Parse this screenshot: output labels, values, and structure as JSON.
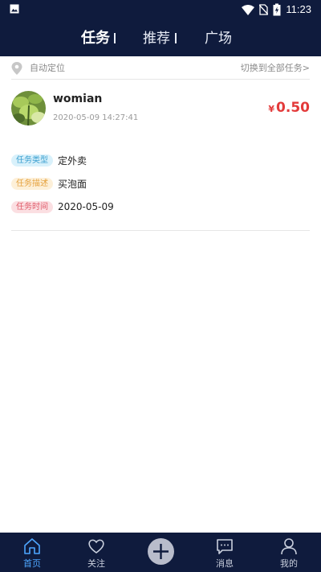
{
  "status_bar": {
    "time": "11:23"
  },
  "top_tabs": [
    {
      "label": "任务",
      "active": true
    },
    {
      "label": "推荐",
      "active": false
    },
    {
      "label": "广场",
      "active": false
    }
  ],
  "location": {
    "label": "自动定位",
    "switch_label": "切换到全部任务>"
  },
  "task": {
    "username": "womian",
    "time": "2020-05-09 14:27:41",
    "price_symbol": "¥",
    "price": "0.50",
    "rows": [
      {
        "tag": "任务类型",
        "value": "定外卖"
      },
      {
        "tag": "任务描述",
        "value": "买泡面"
      },
      {
        "tag": "任务时间",
        "value": "2020-05-09"
      }
    ]
  },
  "bottom_nav": [
    {
      "label": "首页",
      "icon": "home-icon",
      "active": true
    },
    {
      "label": "关注",
      "icon": "heart-icon",
      "active": false
    },
    {
      "label": "",
      "icon": "plus-icon",
      "active": false
    },
    {
      "label": "消息",
      "icon": "message-icon",
      "active": false
    },
    {
      "label": "我的",
      "icon": "user-icon",
      "active": false
    }
  ],
  "colors": {
    "nav_bg": "#0f1b3d",
    "price": "#e33a3a",
    "active_tab": "#4da6ff"
  }
}
